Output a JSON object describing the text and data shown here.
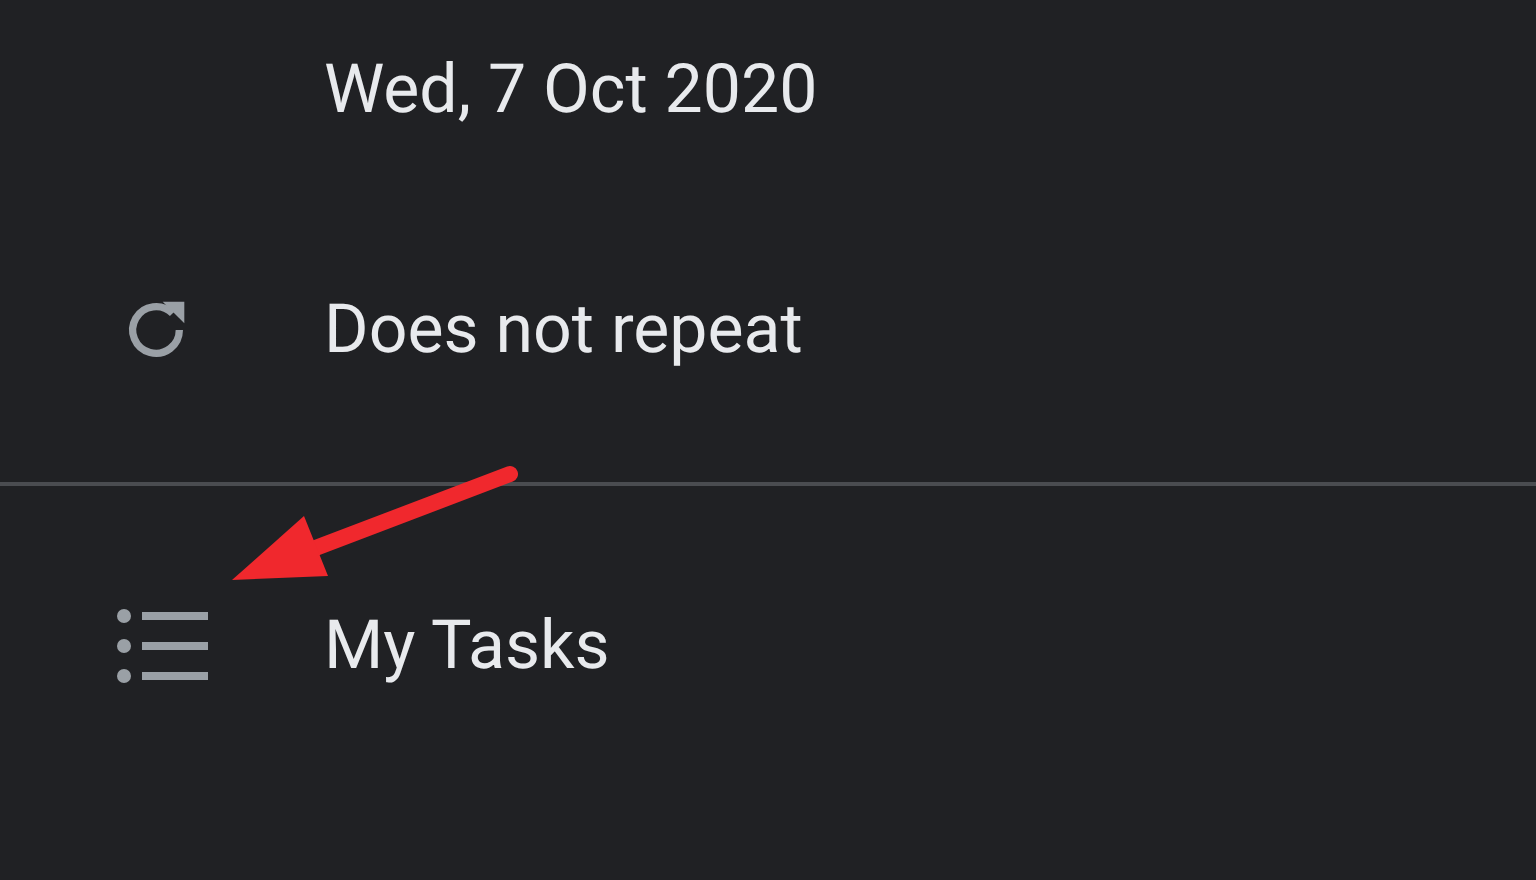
{
  "rows": [
    {
      "kind": "date",
      "label": "Wed, 7 Oct 2020"
    },
    {
      "kind": "repeat",
      "label": "Does not repeat"
    },
    {
      "kind": "divider"
    },
    {
      "kind": "list",
      "label": "My Tasks"
    }
  ]
}
